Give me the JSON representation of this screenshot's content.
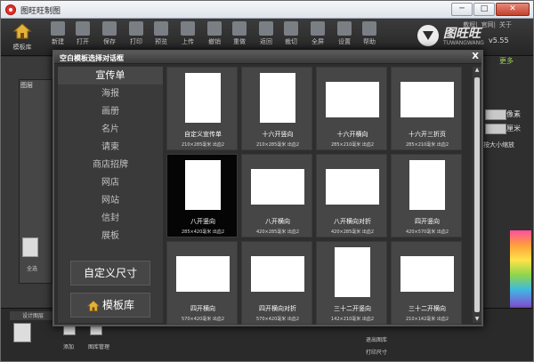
{
  "app": {
    "title": "图旺旺制图"
  },
  "window_buttons": {
    "minimize": "─",
    "maximize": "□",
    "close": "✕"
  },
  "toolbar": {
    "home_label": "模板库",
    "tools": [
      "新建",
      "打开",
      "保存",
      "打印",
      "预览",
      "上传",
      "撤销",
      "重做",
      "返回",
      "裁切",
      "全屏",
      "设置",
      "帮助"
    ],
    "links": [
      "教程",
      "官网",
      "关于"
    ]
  },
  "logo": {
    "text": "图旺旺",
    "sub": "TUWANGWANG",
    "version": "v5.55"
  },
  "workspace": {
    "layers_label": "图层",
    "all_label": "全选",
    "right_items": [
      "像素",
      "厘米",
      "按大小缩放",
      "更多"
    ],
    "bottom_tab": "设计图层",
    "bottom_items": [
      "添加",
      "图库管理",
      "退出图库",
      "打印尺寸"
    ]
  },
  "dialog": {
    "title": "空白模板选择对话框",
    "close": "X",
    "categories": [
      "宣传单",
      "海报",
      "画册",
      "名片",
      "请柬",
      "商店招牌",
      "网店",
      "网站",
      "信封",
      "展板"
    ],
    "active_category": "宣传单",
    "custom_size_button": "自定义尺寸",
    "template_lib_button": "模板库",
    "templates": [
      {
        "name": "自定义宣传单",
        "dims": "210×285毫米  出血2",
        "orientation": "portrait"
      },
      {
        "name": "十六开竖向",
        "dims": "210×285毫米  出血2",
        "orientation": "portrait"
      },
      {
        "name": "十六开横向",
        "dims": "285×210毫米  出血2",
        "orientation": "landscape"
      },
      {
        "name": "十六开三折页",
        "dims": "285×210毫米  出血2",
        "orientation": "landscape"
      },
      {
        "name": "八开竖向",
        "dims": "285×420毫米  出血2",
        "orientation": "portrait",
        "selected": true
      },
      {
        "name": "八开横向",
        "dims": "420×285毫米  出血2",
        "orientation": "landscape"
      },
      {
        "name": "八开横向对折",
        "dims": "420×285毫米  出血2",
        "orientation": "landscape"
      },
      {
        "name": "四开竖向",
        "dims": "420×570毫米  出血2",
        "orientation": "portrait"
      },
      {
        "name": "四开横向",
        "dims": "570×420毫米  出血2",
        "orientation": "landscape"
      },
      {
        "name": "四开横向对折",
        "dims": "570×420毫米  出血2",
        "orientation": "landscape"
      },
      {
        "name": "三十二开竖向",
        "dims": "142×210毫米  出血2",
        "orientation": "portrait"
      },
      {
        "name": "三十二开横向",
        "dims": "210×142毫米  出血2",
        "orientation": "landscape"
      }
    ]
  },
  "colors": {
    "selected_card": "#050505",
    "card": "#464646",
    "dialog_bg": "#2e2e2e"
  }
}
